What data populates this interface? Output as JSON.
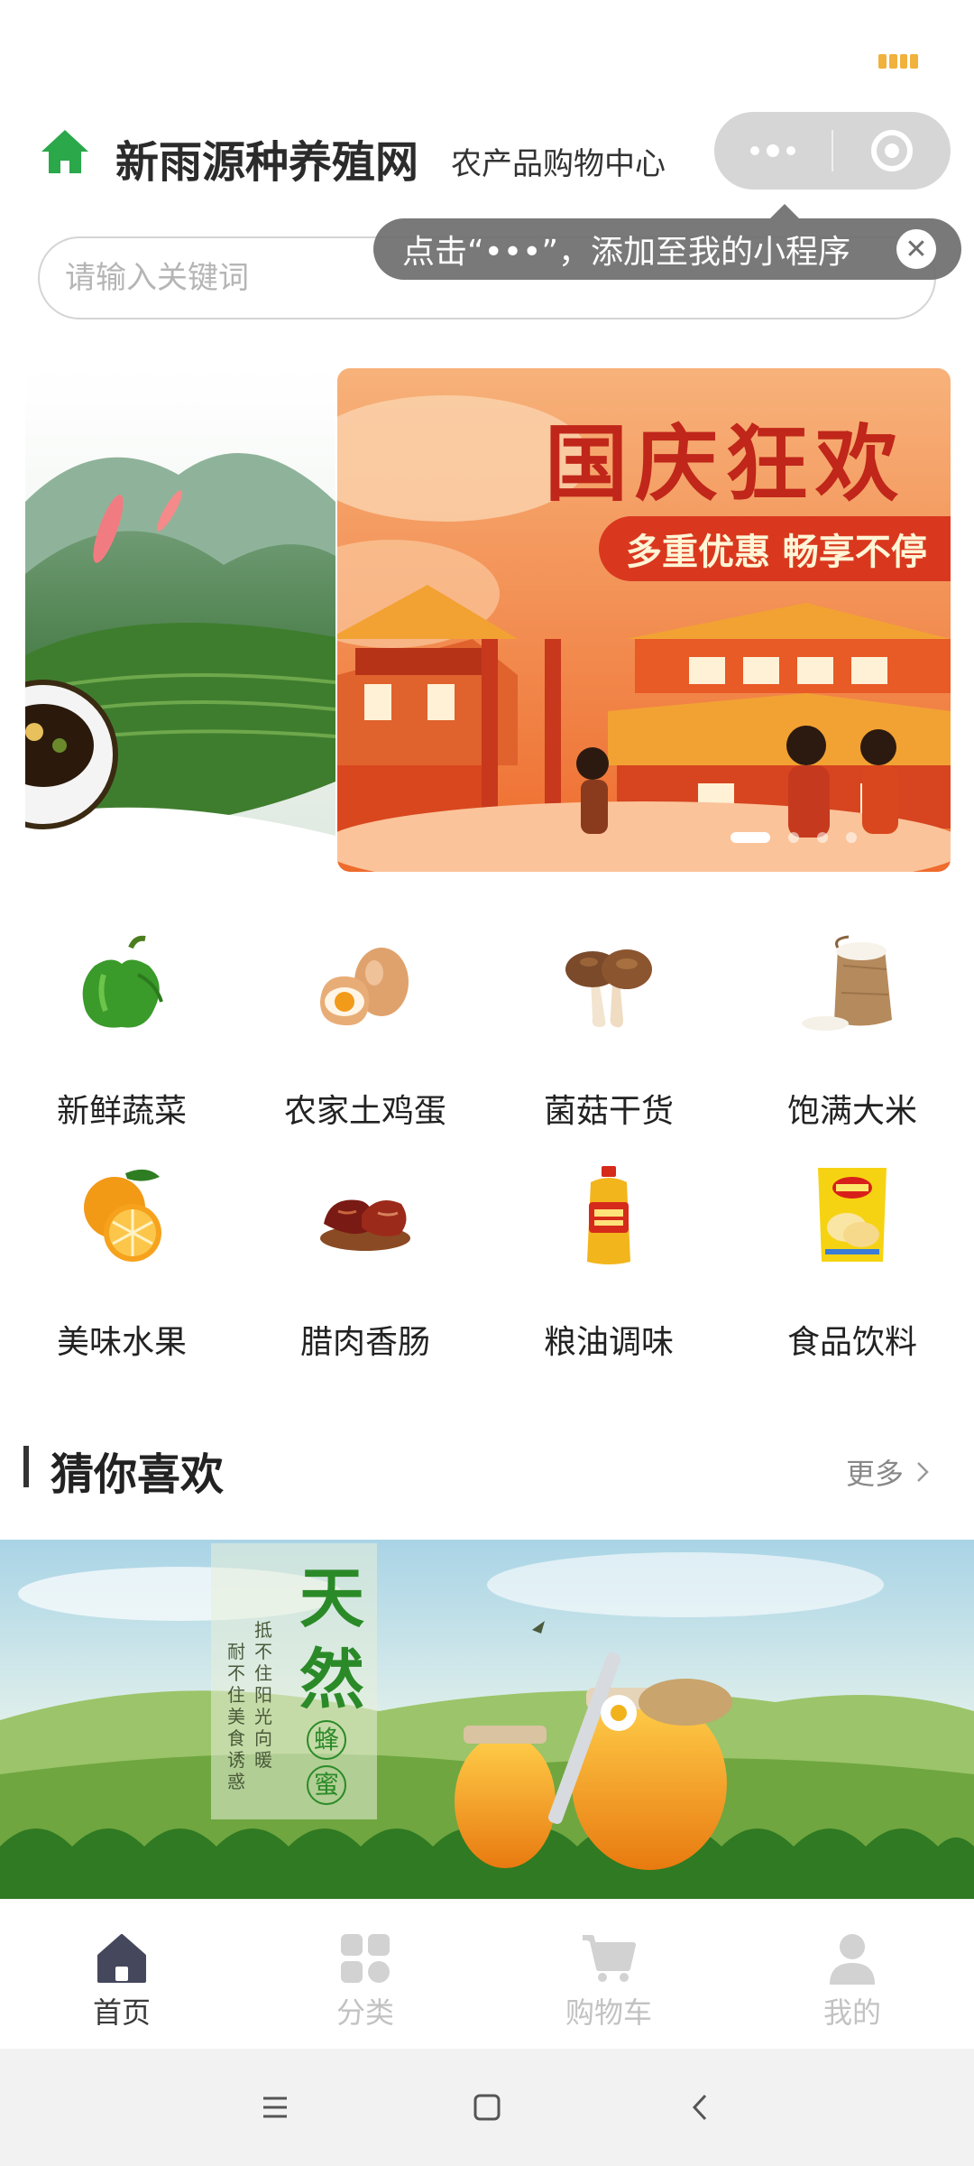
{
  "header": {
    "title": "新雨源种养殖网",
    "subtitle": "农产品购物中心"
  },
  "search": {
    "placeholder": "请输入关键词"
  },
  "tooltip": {
    "text": "点击“•••”，添加至我的小程序"
  },
  "banner": {
    "title": "国庆狂欢",
    "ribbon": "多重优惠 畅享不停",
    "slide_count": 4,
    "active_index": 0
  },
  "categories": [
    {
      "label": "新鲜蔬菜",
      "icon": "green-pepper-icon"
    },
    {
      "label": "农家土鸡蛋",
      "icon": "eggs-icon"
    },
    {
      "label": "菌菇干货",
      "icon": "mushroom-icon"
    },
    {
      "label": "饱满大米",
      "icon": "rice-sack-icon"
    },
    {
      "label": "美味水果",
      "icon": "orange-icon"
    },
    {
      "label": "腊肉香肠",
      "icon": "cured-meat-icon"
    },
    {
      "label": "粮油调味",
      "icon": "cooking-oil-icon"
    },
    {
      "label": "食品饮料",
      "icon": "chips-bag-icon"
    }
  ],
  "recommend": {
    "title": "猜你喜欢",
    "more": "更多",
    "banner_title": "天然",
    "banner_badge_1": "蜂",
    "banner_badge_2": "蜜",
    "banner_poem_1": "抵不住阳光向暖",
    "banner_poem_2": "耐不住美食诱惑"
  },
  "tabbar": [
    {
      "label": "首页",
      "icon": "home-icon",
      "active": true
    },
    {
      "label": "分类",
      "icon": "category-grid-icon",
      "active": false
    },
    {
      "label": "购物车",
      "icon": "cart-icon",
      "active": false
    },
    {
      "label": "我的",
      "icon": "user-icon",
      "active": false
    }
  ],
  "colors": {
    "brand_green": "#2aa84a",
    "banner_red": "#c0261a",
    "tab_active": "#3a3a3a",
    "tab_inactive": "#c2c2c2"
  }
}
